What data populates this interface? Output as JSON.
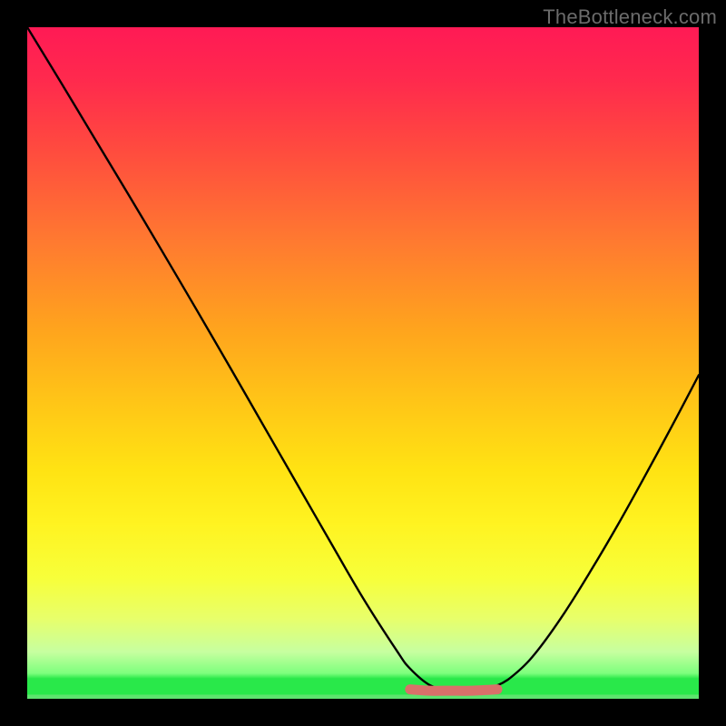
{
  "watermark": "TheBottleneck.com",
  "gradient": {
    "top": "#ff1a55",
    "mid_upper": "#ff7a30",
    "mid": "#ffe313",
    "mid_lower": "#e8ff6a",
    "bright_band": "#29e84a",
    "bottom_band": "#5de36e"
  },
  "chart_data": {
    "type": "line",
    "title": "",
    "xlabel": "",
    "ylabel": "",
    "xlim": [
      0,
      100
    ],
    "ylim": [
      0,
      100
    ],
    "grid": false,
    "legend": false,
    "annotations": [],
    "series": [
      {
        "name": "bottleneck-curve",
        "color": "#000000",
        "x": [
          0,
          5,
          10,
          15,
          20,
          25,
          30,
          35,
          40,
          45,
          50,
          55,
          57,
          60,
          63,
          66,
          70,
          73,
          76,
          80,
          84,
          88,
          92,
          96,
          100
        ],
        "y": [
          100,
          91.8,
          83.5,
          75.2,
          66.8,
          58.3,
          49.7,
          41.0,
          32.3,
          23.6,
          15.0,
          7.2,
          4.5,
          2.0,
          1.2,
          1.2,
          2.0,
          4.0,
          7.2,
          12.8,
          19.2,
          26.0,
          33.2,
          40.6,
          48.2
        ]
      },
      {
        "name": "flat-bottom-highlight",
        "color": "#d9706a",
        "x": [
          57,
          60,
          63,
          66,
          70
        ],
        "y": [
          1.4,
          1.2,
          1.2,
          1.2,
          1.4
        ]
      }
    ]
  }
}
